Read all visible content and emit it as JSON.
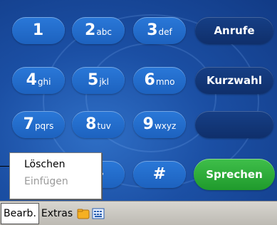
{
  "keypad": {
    "keys": [
      {
        "digit": "1",
        "letters": ""
      },
      {
        "digit": "2",
        "letters": "abc"
      },
      {
        "digit": "3",
        "letters": "def"
      },
      {
        "digit": "4",
        "letters": "ghi"
      },
      {
        "digit": "5",
        "letters": "jkl"
      },
      {
        "digit": "6",
        "letters": "mno"
      },
      {
        "digit": "7",
        "letters": "pqrs"
      },
      {
        "digit": "8",
        "letters": "tuv"
      },
      {
        "digit": "9",
        "letters": "wxyz"
      },
      {
        "digit": "+",
        "letters": ""
      },
      {
        "digit": "#",
        "letters": ""
      }
    ],
    "side_buttons": {
      "calls": "Anrufe",
      "speed_dial": "Kurzwahl",
      "empty": ""
    },
    "talk_button": "Sprechen"
  },
  "context_menu": {
    "items": [
      {
        "label": "Löschen",
        "enabled": true
      },
      {
        "label": "Einfügen",
        "enabled": false
      }
    ]
  },
  "taskbar": {
    "edit_label": "Bearb.",
    "extras_label": "Extras",
    "icons": [
      "folder-icon",
      "keyboard-icon"
    ]
  },
  "colors": {
    "key_blue": "#1d62bf",
    "side_navy": "#0f2f6b",
    "talk_green": "#1f9a2c",
    "background": "#1b4fa4"
  }
}
